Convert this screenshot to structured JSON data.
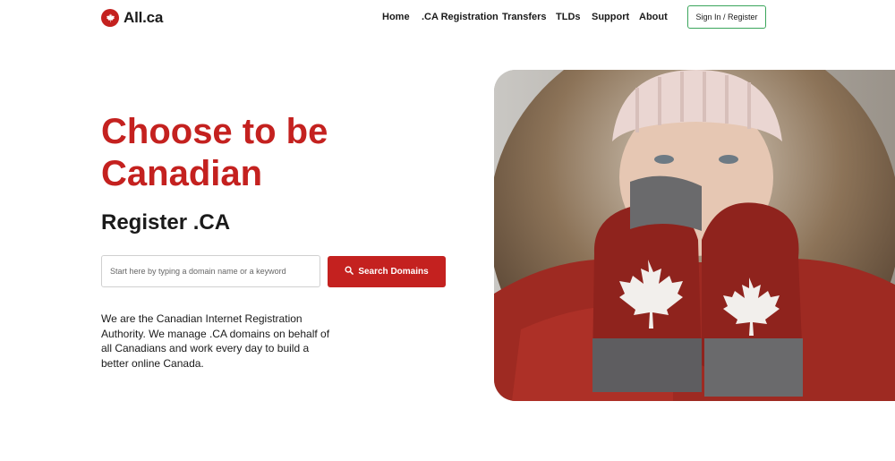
{
  "header": {
    "logo_text": "All.ca",
    "nav": [
      "Home",
      ".CA Registration",
      "Transfers",
      "TLDs",
      "Support",
      "About"
    ],
    "signin_label": "Sign In / Register"
  },
  "hero": {
    "title": "Choose to be Canadian",
    "subtitle": "Register .CA",
    "search_placeholder": "Start here by typing a domain name or a keyword",
    "search_button": "Search Domains",
    "description": "We are the Canadian Internet Registration Authority. We manage .CA domains on behalf of all Canadians and work every day to build a better online Canada."
  },
  "colors": {
    "brand_red": "#c4211f",
    "signin_border": "#3aa55b"
  },
  "icons": {
    "logo": "maple-leaf-icon",
    "search": "search-icon"
  }
}
